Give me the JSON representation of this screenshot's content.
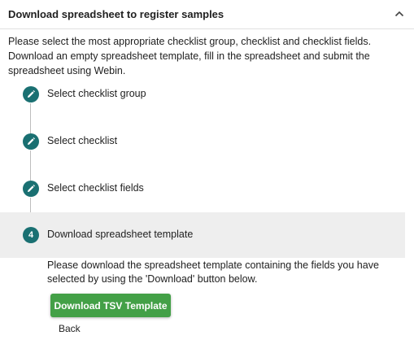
{
  "panel": {
    "title": "Download spreadsheet to register samples",
    "collapse_icon": "chevron-up-icon",
    "description": "Please select the most appropriate checklist group, checklist and checklist fields. Download an empty spreadsheet template, fill in the spreadsheet and submit the spreadsheet using Webin."
  },
  "steps": [
    {
      "label": "Select checklist group",
      "state": "completed",
      "icon": "pencil-icon"
    },
    {
      "label": "Select checklist",
      "state": "completed",
      "icon": "pencil-icon"
    },
    {
      "label": "Select checklist fields",
      "state": "completed",
      "icon": "pencil-icon"
    },
    {
      "label": "Download spreadsheet template",
      "state": "active",
      "number": "4"
    }
  ],
  "active_step": {
    "instructions": "Please download the spreadsheet template containing the fields you have selected by using the 'Download' button below.",
    "download_label": "Download TSV Template",
    "back_label": "Back"
  },
  "colors": {
    "step_circle": "#1a7072",
    "download_button": "#43a047",
    "active_step_background": "#eeeeee"
  }
}
